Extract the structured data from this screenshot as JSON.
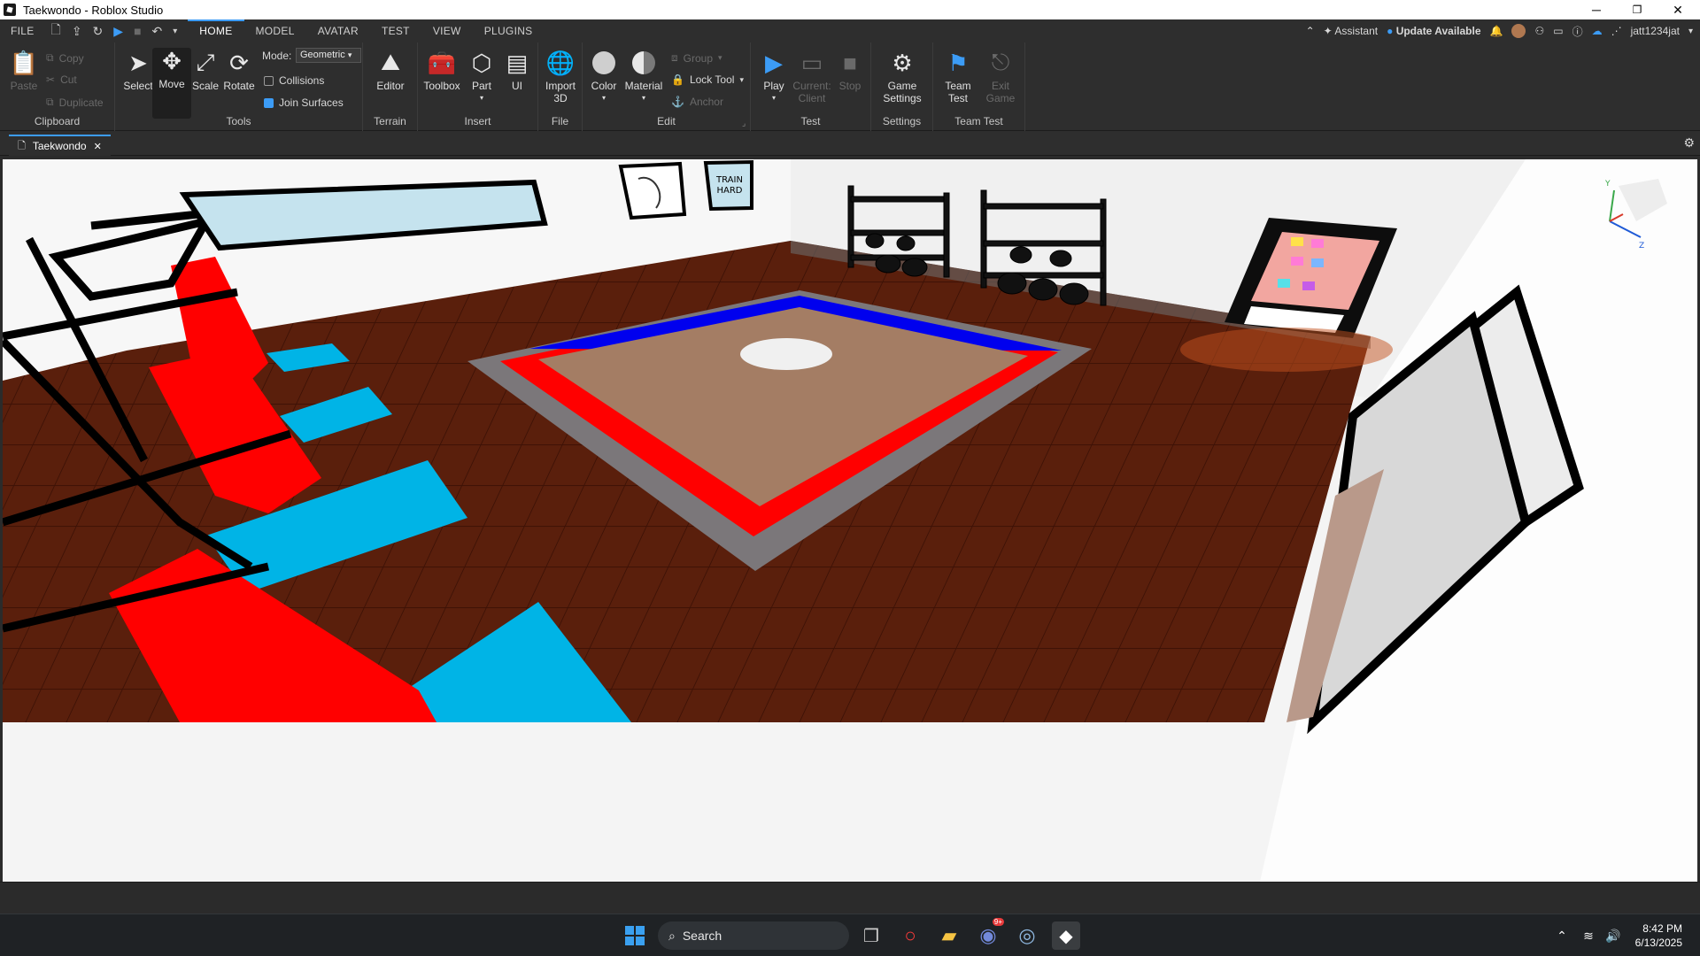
{
  "window": {
    "title": "Taekwondo - Roblox Studio",
    "minimize": "─",
    "restore": "❐",
    "close": "✕"
  },
  "menu": {
    "file": "FILE",
    "tabs": [
      "HOME",
      "MODEL",
      "AVATAR",
      "TEST",
      "VIEW",
      "PLUGINS"
    ],
    "assistant": "Assistant",
    "update": "Update Available",
    "user": "jatt1234jat"
  },
  "ribbon": {
    "clipboard": {
      "name": "Clipboard",
      "paste": "Paste",
      "copy": "Copy",
      "cut": "Cut",
      "duplicate": "Duplicate"
    },
    "tools": {
      "name": "Tools",
      "select": "Select",
      "move": "Move",
      "scale": "Scale",
      "rotate": "Rotate",
      "mode_label": "Mode:",
      "mode_value": "Geometric",
      "collisions": "Collisions",
      "join_surfaces": "Join Surfaces"
    },
    "terrain": {
      "name": "Terrain",
      "editor": "Editor"
    },
    "insert": {
      "name": "Insert",
      "toolbox": "Toolbox",
      "part": "Part",
      "ui": "UI"
    },
    "file": {
      "name": "File",
      "import": "Import",
      "import2": "3D"
    },
    "edit": {
      "name": "Edit",
      "color": "Color",
      "material": "Material",
      "group": "Group",
      "lock_tool": "Lock Tool",
      "anchor": "Anchor"
    },
    "test": {
      "name": "Test",
      "play": "Play",
      "current": "Current:",
      "client": "Client",
      "stop": "Stop"
    },
    "settings": {
      "name": "Settings",
      "game": "Game",
      "settings": "Settings"
    },
    "team_test": {
      "name": "Team Test",
      "team": "Team",
      "test": "Test",
      "exit": "Exit",
      "game": "Game"
    }
  },
  "document_tab": {
    "label": "Taekwondo"
  },
  "scene": {
    "poster_text_line1": "TRAIN",
    "poster_text_line2": "HARD",
    "axis_y": "Y",
    "axis_z": "Z"
  },
  "taskbar": {
    "search_placeholder": "Search",
    "time": "8:42 PM",
    "date": "6/13/2025",
    "discord_badge": "9+"
  },
  "colors": {
    "accent": "#3c9cf6",
    "floor": "#5a1f0c",
    "ring_red": "#ff0000",
    "ring_blue": "#0000ee",
    "mat_cyan": "#00b4e6"
  }
}
